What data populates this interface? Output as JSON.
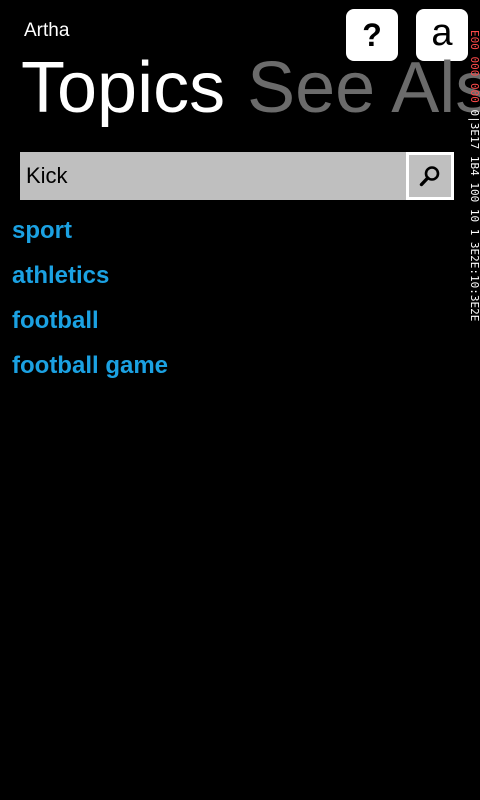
{
  "app": {
    "title": "Artha"
  },
  "toolbar": {
    "help_label": "?",
    "az_label": "a"
  },
  "pivot": {
    "active": "Topics",
    "inactive": "See Als"
  },
  "search": {
    "value": "Kick",
    "placeholder": ""
  },
  "results": [
    "sport",
    "athletics",
    "football",
    "football game"
  ],
  "debug": {
    "red_text": "E00 000 000 ",
    "white_text": "0|3E17 1B4 100 10 1 3E2E:10:3E2E"
  },
  "colors": {
    "background": "#000000",
    "accent": "#1ba1e2",
    "search_bg": "#bfbfbf",
    "inactive_pivot": "#6b6b6b"
  }
}
